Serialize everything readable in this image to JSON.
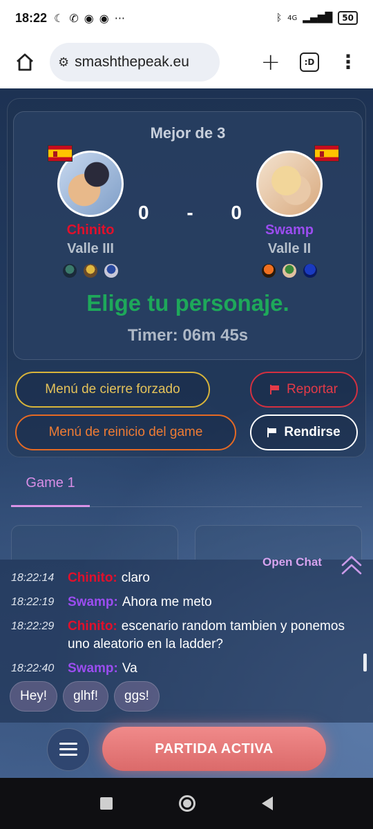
{
  "status_bar": {
    "time": "18:22",
    "left_icons": [
      "moon-icon",
      "whatsapp-icon",
      "discord-icon",
      "discord-icon",
      "more-icon"
    ],
    "right_icons": [
      "bluetooth-icon",
      "network-4g-icon",
      "signal-icon"
    ],
    "battery": "50"
  },
  "browser": {
    "url": "smashthepeak.eu",
    "tabs_count": ":D"
  },
  "match": {
    "title": "Mejor de 3",
    "player1": {
      "name": "Chinito",
      "rank": "Valle III",
      "score": "0",
      "color": "#e1102b",
      "characters": [
        "char-green",
        "char-yellow",
        "char-blue"
      ]
    },
    "player2": {
      "name": "Swamp",
      "rank": "Valle II",
      "score": "0",
      "color": "#9b4df0",
      "characters": [
        "char-orange",
        "char-dark",
        "char-sonic"
      ]
    },
    "separator": "-",
    "status": "Elige tu personaje.",
    "timer": "Timer: 06m 45s"
  },
  "actions": {
    "forced_close": "Menú de cierre forzado",
    "report": "Reportar",
    "restart": "Menú de reinicio del game",
    "surrender": "Rendirse"
  },
  "tabs": [
    {
      "label": "Game 1"
    }
  ],
  "chat": {
    "open_label": "Open Chat",
    "messages": [
      {
        "time": "18:22:14",
        "user": "Chinito:",
        "text": "claro"
      },
      {
        "time": "18:22:19",
        "user": "Swamp:",
        "text": "Ahora me meto"
      },
      {
        "time": "18:22:29",
        "user": "Chinito:",
        "text": "escenario random tambien y ponemos uno aleatorio en la ladder?"
      },
      {
        "time": "18:22:40",
        "user": "Swamp:",
        "text": "Va"
      }
    ],
    "quick_replies": [
      "Hey!",
      "glhf!",
      "ggs!"
    ]
  },
  "bottom": {
    "active_label": "PARTIDA ACTIVA"
  }
}
